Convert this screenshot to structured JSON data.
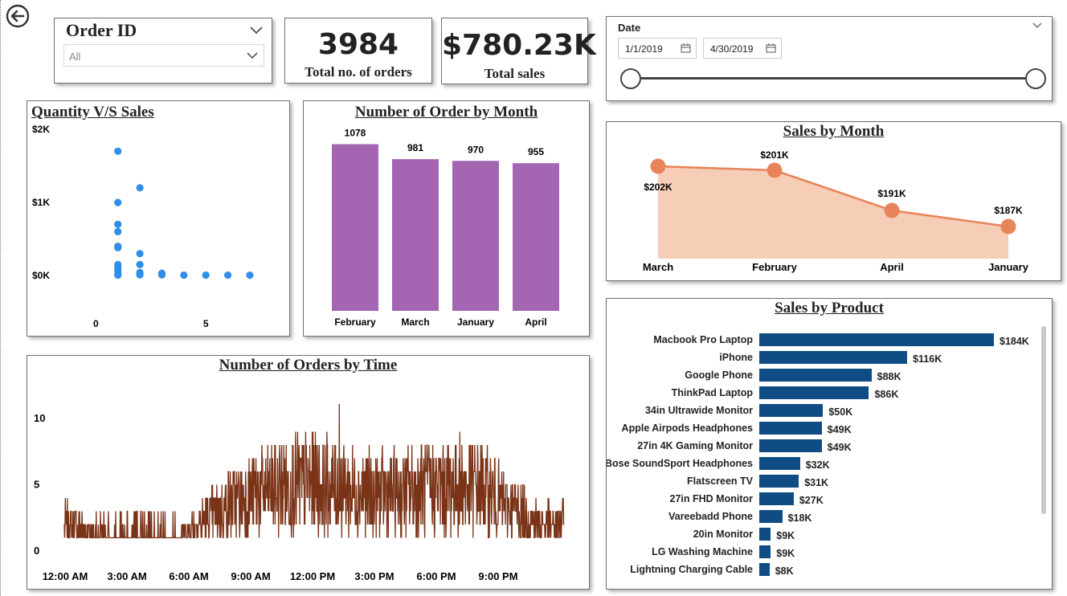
{
  "slicer_order": {
    "title": "Order ID",
    "value": "All"
  },
  "kpi_orders": {
    "value": "3984",
    "label": "Total no. of orders"
  },
  "kpi_sales": {
    "value": "$780.23K",
    "label": "Total sales"
  },
  "date_slicer": {
    "title": "Date",
    "start": "1/1/2019",
    "end": "4/30/2019"
  },
  "colors": {
    "scatter": "#2f8ee8",
    "bar_month": "#a466b2",
    "area_line": "#e8845a",
    "area_fill": "#f6cdb7",
    "product_bar": "#0e4c83",
    "time_line": "#7a3317"
  },
  "icons": {
    "back": "back-arrow-icon",
    "chevron": "chevron-down-icon",
    "calendar": "calendar-icon"
  },
  "chart_data": [
    {
      "id": "qty_vs_sales",
      "type": "scatter",
      "title": "Quantity V/S Sales",
      "xlabel": "",
      "ylabel": "",
      "x_ticks": [
        "0",
        "5"
      ],
      "y_ticks": [
        "$0K",
        "$1K",
        "$2K"
      ],
      "xlim": [
        -1,
        8.5
      ],
      "ylim": [
        0,
        2000
      ],
      "points": [
        [
          1,
          1700
        ],
        [
          1,
          999
        ],
        [
          1,
          700
        ],
        [
          1,
          600
        ],
        [
          1,
          400
        ],
        [
          1,
          380
        ],
        [
          1,
          150
        ],
        [
          1,
          100
        ],
        [
          1,
          60
        ],
        [
          1,
          20
        ],
        [
          1,
          5
        ],
        [
          2,
          1200
        ],
        [
          2,
          300
        ],
        [
          2,
          150
        ],
        [
          2,
          40
        ],
        [
          2,
          10
        ],
        [
          3,
          30
        ],
        [
          3,
          10
        ],
        [
          4,
          5
        ],
        [
          5,
          5
        ],
        [
          6,
          5
        ],
        [
          7,
          5
        ]
      ]
    },
    {
      "id": "orders_by_month",
      "type": "bar",
      "title": "Number of Order by Month",
      "categories": [
        "February",
        "March",
        "January",
        "April"
      ],
      "values": [
        1078,
        981,
        970,
        955
      ],
      "ylim": [
        0,
        1200
      ]
    },
    {
      "id": "sales_by_month",
      "type": "area",
      "title": "Sales by Month",
      "categories": [
        "March",
        "February",
        "April",
        "January"
      ],
      "values": [
        202,
        201,
        191,
        187
      ],
      "labels": [
        "$202K",
        "$201K",
        "$191K",
        "$187K"
      ],
      "ylim": [
        180,
        205
      ]
    },
    {
      "id": "sales_by_product",
      "type": "bar",
      "title": "Sales by Product",
      "orientation": "horizontal",
      "categories": [
        "Macbook Pro Laptop",
        "iPhone",
        "Google Phone",
        "ThinkPad Laptop",
        "34in Ultrawide Monitor",
        "Apple Airpods Headphones",
        "27in 4K Gaming Monitor",
        "Bose SoundSport Headphones",
        "Flatscreen TV",
        "27in FHD Monitor",
        "Vareebadd Phone",
        "20in Monitor",
        "LG Washing Machine",
        "Lightning Charging Cable"
      ],
      "values": [
        184,
        116,
        88,
        86,
        50,
        49,
        49,
        32,
        31,
        27,
        18,
        9,
        9,
        8
      ],
      "labels": [
        "$184K",
        "$116K",
        "$88K",
        "$86K",
        "$50K",
        "$49K",
        "$49K",
        "$32K",
        "$31K",
        "$27K",
        "$18K",
        "$9K",
        "$9K",
        "$8K"
      ]
    },
    {
      "id": "orders_by_time",
      "type": "line",
      "title": "Number of Orders by Time",
      "x_ticks": [
        "12:00 AM",
        "3:00 AM",
        "6:00 AM",
        "9:00 AM",
        "12:00 PM",
        "3:00 PM",
        "6:00 PM",
        "9:00 PM"
      ],
      "y_ticks": [
        "0",
        "5",
        "10"
      ],
      "ylim": [
        0,
        12
      ],
      "xlim": [
        0,
        24
      ],
      "hourly_avg": [
        2.1,
        1.6,
        0.8,
        0.6,
        0.6,
        0.9,
        1.6,
        2.6,
        3.6,
        4.3,
        4.6,
        5.0,
        5.2,
        4.8,
        4.5,
        4.3,
        4.4,
        4.6,
        4.8,
        5.0,
        4.6,
        3.7,
        2.8,
        2.0
      ],
      "peak": 11.1
    }
  ]
}
